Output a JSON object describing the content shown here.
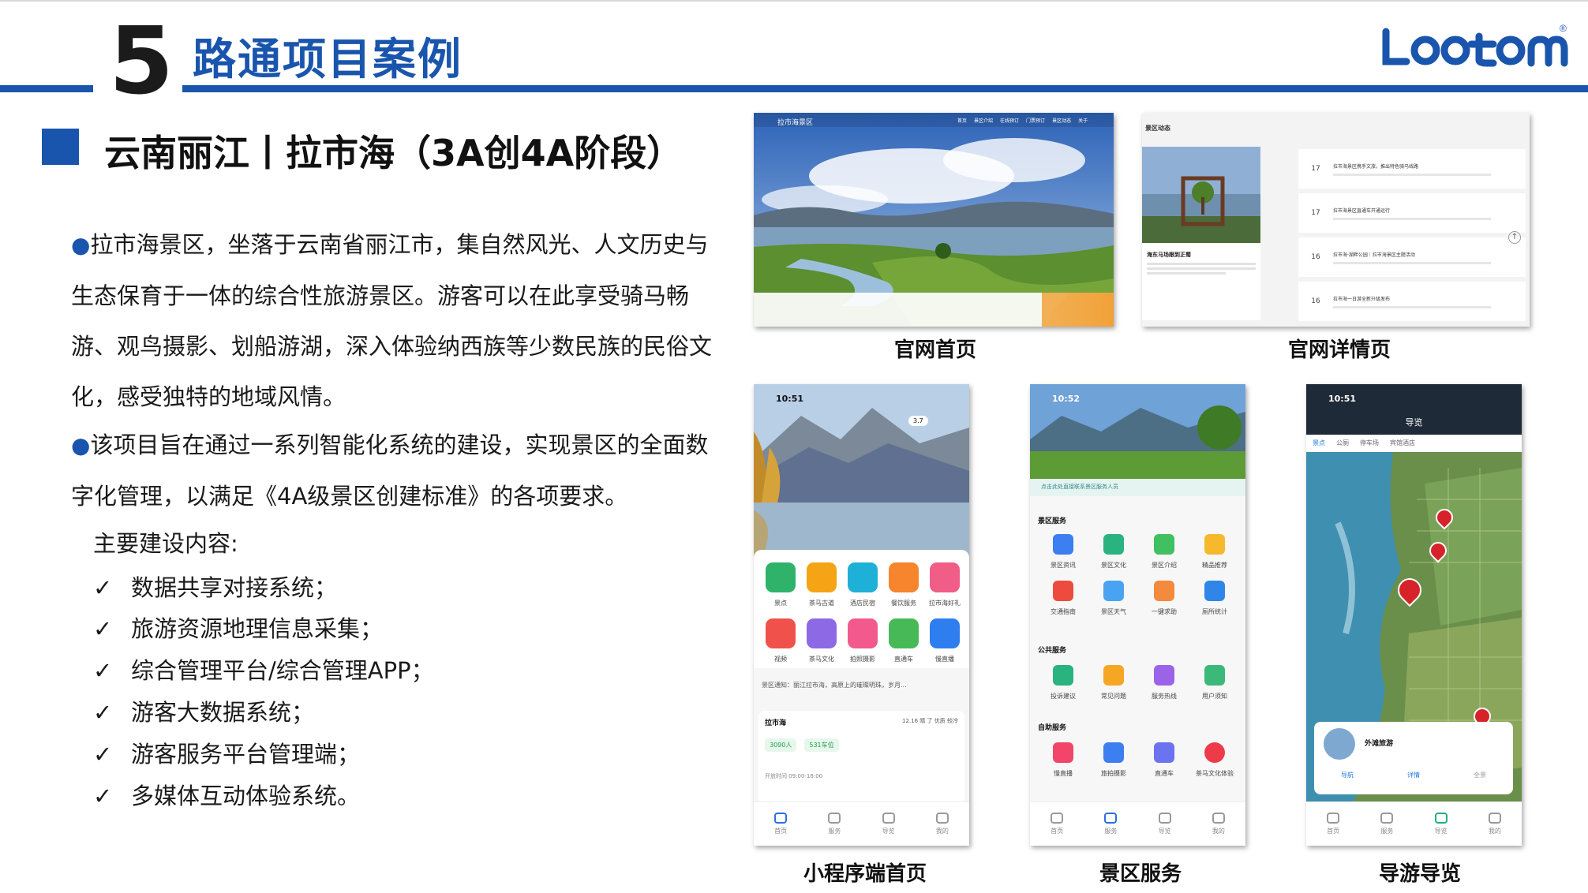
{
  "header": {
    "section_number": "5",
    "title": "路通项目案例",
    "logo_text": "LOOTOM®",
    "accent": "#1a55ad"
  },
  "subtitle": "云南丽江丨拉市海（3A创4A阶段）",
  "body": {
    "para1": "拉市海景区，坐落于云南省丽江市，集自然风光、人文历史与生态保育于一体的综合性旅游景区。游客可以在此享受骑马畅游、观鸟摄影、划船游湖，深入体验纳西族等少数民族的民俗文化，感受独特的地域风情。",
    "para2": "该项目旨在通过一系列智能化系统的建设，实现景区的全面数字化管理，以满足《4A级景区创建标准》的各项要求。",
    "main_label": "主要建设内容:",
    "checklist": [
      "数据共享对接系统；",
      "旅游资源地理信息采集；",
      "综合管理平台/综合管理APP；",
      "游客大数据系统；",
      "游客服务平台管理端；",
      "多媒体互动体验系统。"
    ],
    "check_mark": "✓"
  },
  "screens": {
    "web_home_caption": "官网首页",
    "web_detail_caption": "官网详情页",
    "mini_home_caption": "小程序端首页",
    "services_caption": "景区服务",
    "guide_caption": "导游导览",
    "phone_time_1": "10:51",
    "phone_time_2": "10:52",
    "phone_time_3": "10:51",
    "mini_home": {
      "weather": "3.7",
      "icons_row1": [
        "景点",
        "茶马古道",
        "酒店民宿",
        "餐饮服务",
        "拉市海好礼"
      ],
      "icons_row2": [
        "视频",
        "茶马文化",
        "拍照摄影",
        "直通车",
        "慢直播"
      ],
      "notice": "景区通知：丽江拉市海，高原上的璀璨明珠，岁月...",
      "site_name": "拉市海",
      "weather_row": "12.16  晴 了  优质  较冷",
      "visitors": "3090人",
      "parking": "531车位",
      "open_time": "开放时间 09:00-18:00",
      "tabs": [
        "首页",
        "服务",
        "导览",
        "我的"
      ]
    },
    "services": {
      "banner_text": "点击此处直接联系景区服务人员",
      "sec1_title": "景区服务",
      "sec1_items": [
        "景区资讯",
        "景区文化",
        "景区介绍",
        "精品推荐",
        "交通指南",
        "景区天气",
        "一键求助",
        "厕所统计"
      ],
      "sec2_title": "公共服务",
      "sec2_items": [
        "投诉建议",
        "常见问题",
        "服务热线",
        "用户须知"
      ],
      "sec3_title": "自助服务",
      "sec3_items": [
        "慢直播",
        "旅拍摄影",
        "直通车",
        "茶马文化体验"
      ],
      "tabs": [
        "首页",
        "服务",
        "导览",
        "我的"
      ]
    },
    "guide": {
      "title": "导览",
      "filter_tabs": [
        "景点",
        "公厕",
        "停车场",
        "宾馆酒店"
      ],
      "card_title": "外滩旅游",
      "card_actions": [
        "导航",
        "详情",
        "全景"
      ],
      "tabs": [
        "首页",
        "服务",
        "导览",
        "我的"
      ]
    },
    "web_home": {
      "site_title": "拉市海景区",
      "nav": [
        "首页",
        "景区介绍",
        "在线预订",
        "门票预订",
        "景区动态",
        "关于"
      ]
    },
    "web_detail": {
      "section_title": "景区动态",
      "card_title": "海东马场跟到正蜀",
      "news": [
        {
          "day": "17",
          "title": "拉市海景区携手文旅，推出特色骑马线路"
        },
        {
          "day": "17",
          "title": "拉市海景区直通车开通运行"
        },
        {
          "day": "16",
          "title": "拉市海·湖畔公园｜拉市海景区主题活动"
        },
        {
          "day": "16",
          "title": "拉市海一日游全新升级发布"
        }
      ]
    }
  }
}
